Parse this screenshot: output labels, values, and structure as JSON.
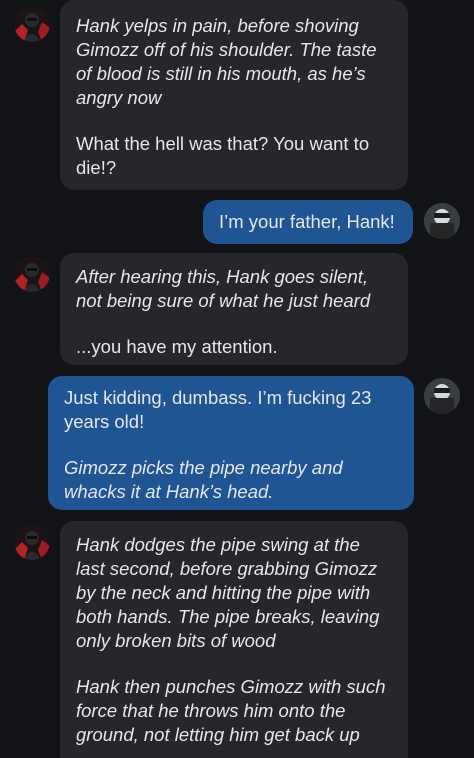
{
  "messages": [
    {
      "sender": "bot",
      "action": "Hank yelps in pain, before shoving Gimozz off of his shoulder. The taste of blood is still in his mouth, as he’s angry now",
      "text": "What the hell was that? You want to die!?"
    },
    {
      "sender": "user",
      "text": "I’m your father, Hank!"
    },
    {
      "sender": "bot",
      "action": "After hearing this, Hank goes silent, not being sure of what he just heard",
      "text": "...you have my attention."
    },
    {
      "sender": "user",
      "text": "Just kidding, dumbass. I’m fucking 23 years old!",
      "action": "Gimozz picks the pipe nearby and whacks it at Hank’s head."
    },
    {
      "sender": "bot",
      "action": "Hank dodges the pipe swing at the last second, before grabbing Gimozz by the neck and hitting the pipe with both hands. The pipe breaks, leaving only broken bits of wood",
      "action2": "Hank then punches Gimozz with such force that he throws him onto the ground, not letting him get back up"
    }
  ],
  "avatars": {
    "bot": "character-avatar",
    "user": "user-avatar"
  },
  "colors": {
    "background": "#121316",
    "bot_bubble": "#25272c",
    "user_bubble": "#1f5593",
    "text": "#e6e7ea"
  }
}
